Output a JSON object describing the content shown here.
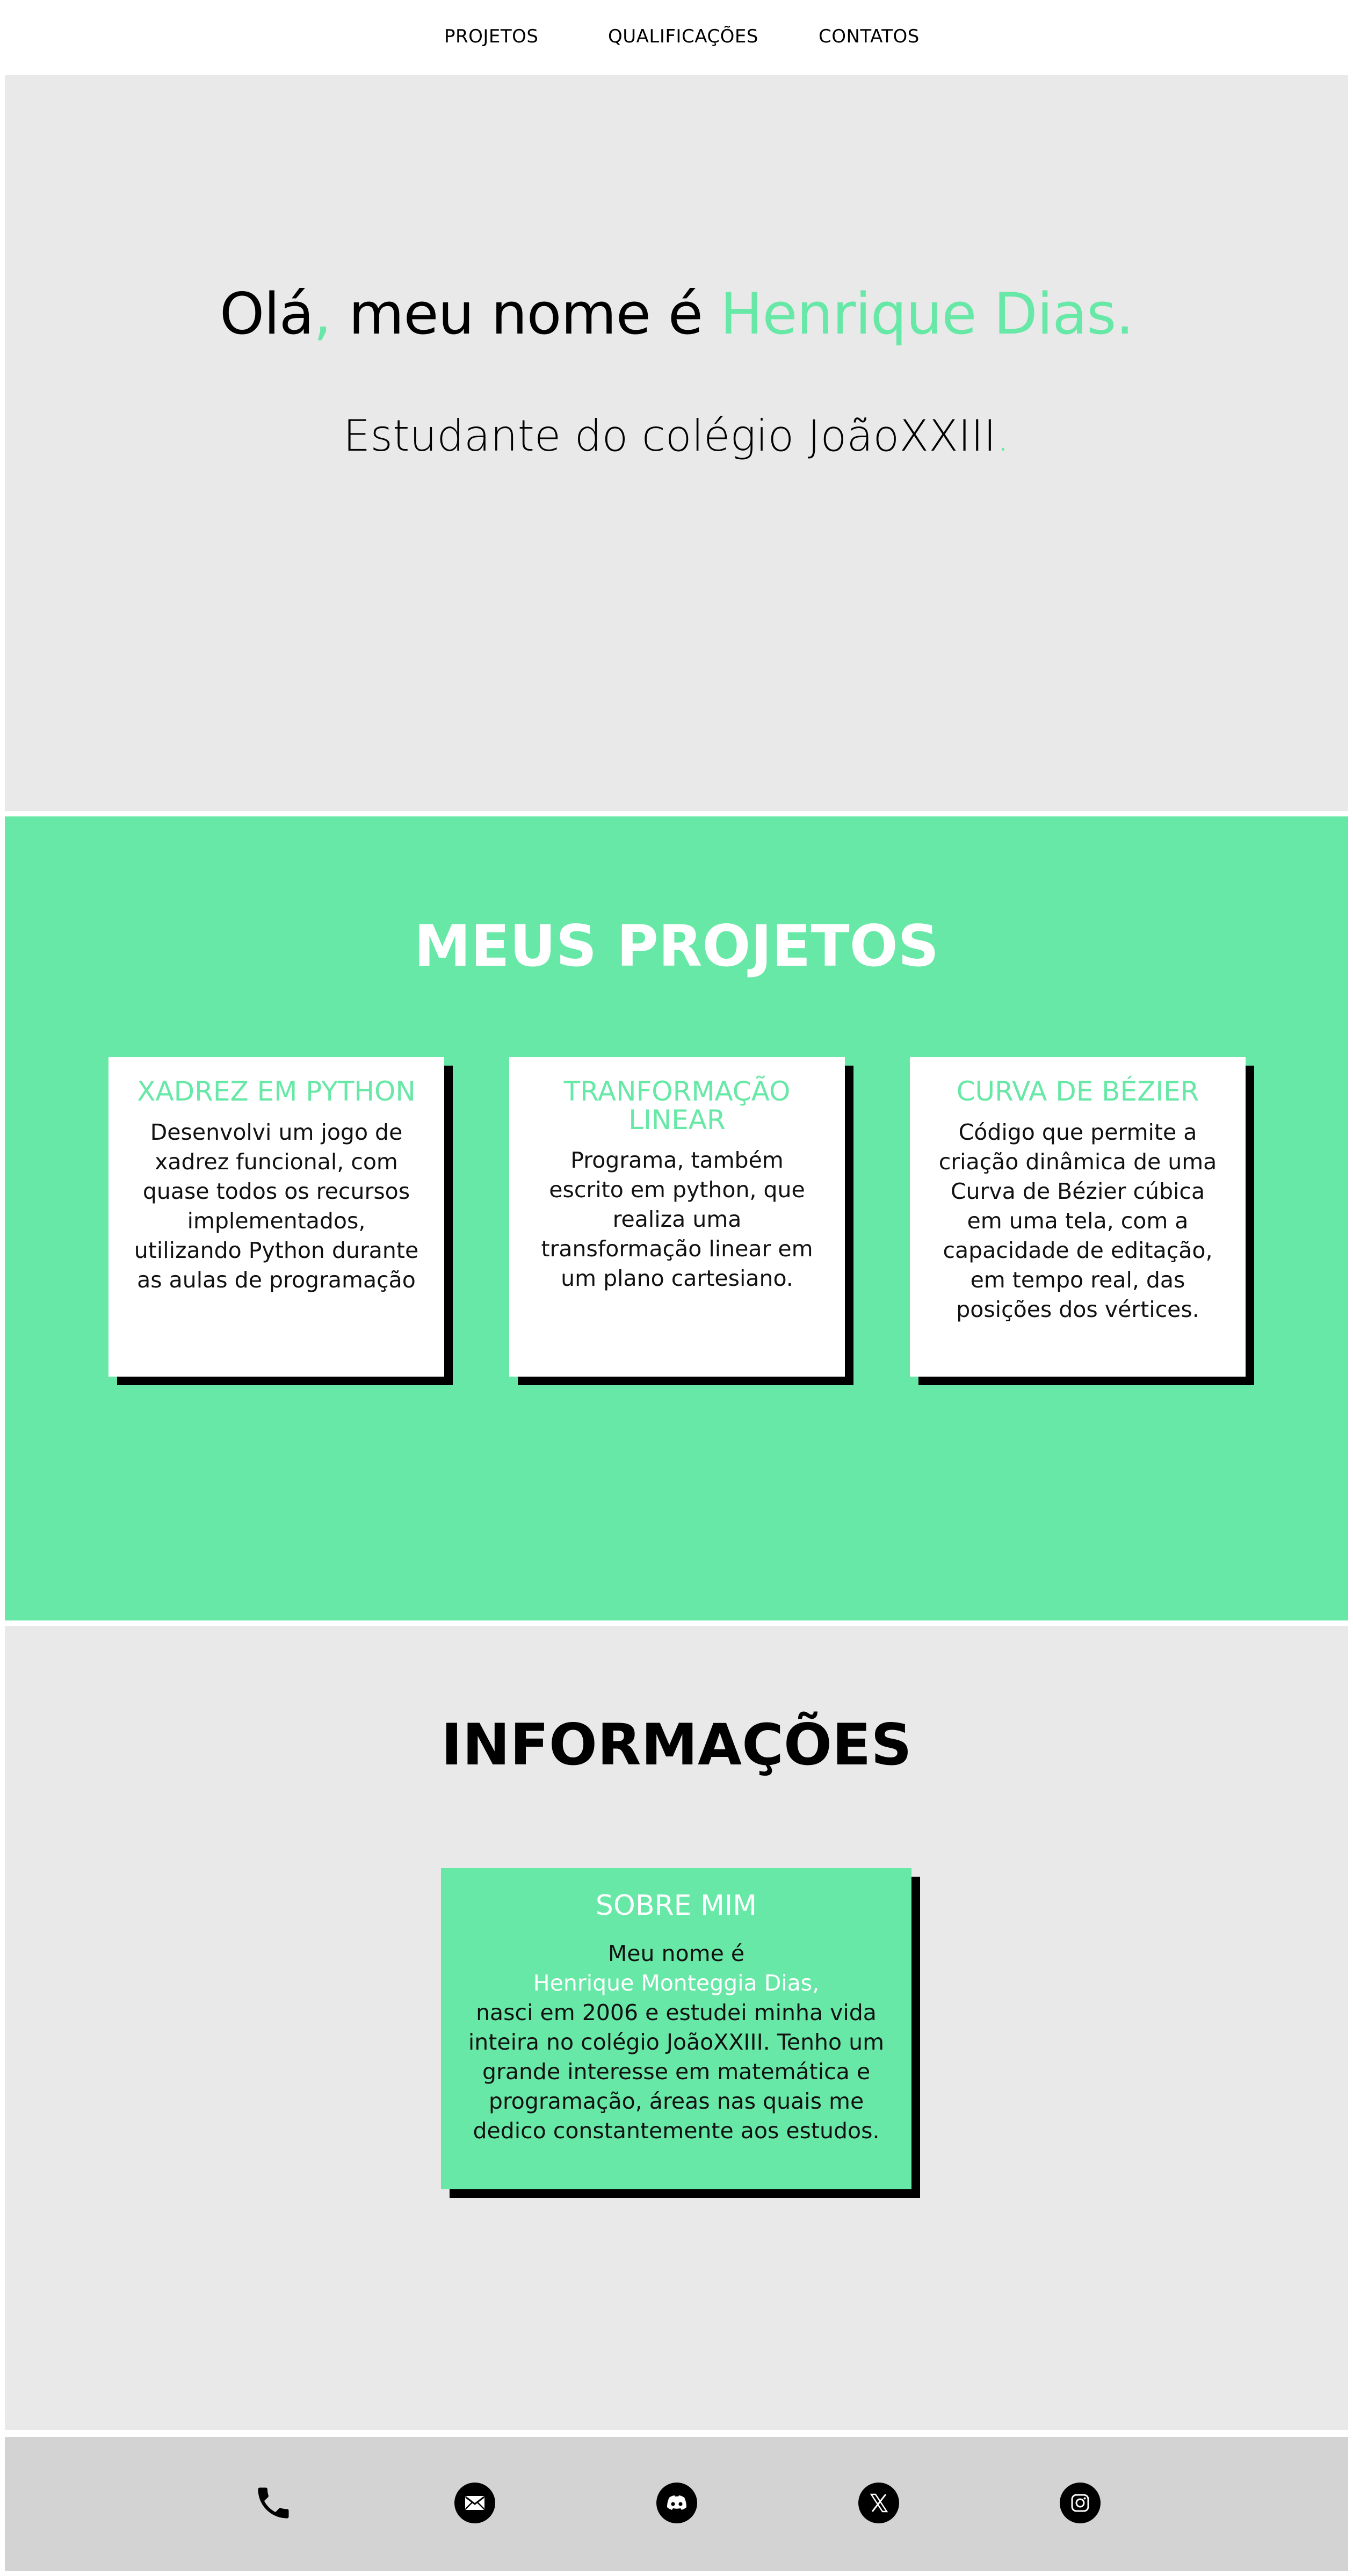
{
  "nav": {
    "items": [
      {
        "label": "PROJETOS"
      },
      {
        "label": "QUALIFICAÇÕES"
      },
      {
        "label": "CONTATOS"
      }
    ]
  },
  "hero": {
    "title_part1": "Olá",
    "title_comma": ",",
    "title_part2": " meu nome é ",
    "title_name": "Henrique Dias.",
    "subtitle": "Estudante do colégio JoãoXXIII",
    "subtitle_dot": "."
  },
  "projects": {
    "title": "MEUS PROJETOS",
    "cards": [
      {
        "title": "XADREZ EM PYTHON",
        "text": "Desenvolvi um jogo de xadrez funcional, com quase todos os recursos implementados, utilizando Python durante as aulas de programação"
      },
      {
        "title": "TRANFORMAÇÃO LINEAR",
        "text": "Programa, também escrito em python, que realiza uma transformação linear em um plano cartesiano."
      },
      {
        "title": "CURVA DE BÉZIER",
        "text": "Código que permite a criação dinâmica de uma Curva de Bézier cúbica em uma tela, com a capacidade de editação, em tempo real, das posições dos vértices."
      }
    ]
  },
  "info": {
    "title": "INFORMAÇÕES",
    "about": {
      "title": "SOBRE MIM",
      "intro": "Meu nome é",
      "name": "Henrique Monteggia Dias,",
      "text": "nasci em 2006 e estudei minha vida inteira no colégio JoãoXXIII. Tenho um grande interesse em matemática e programação, áreas nas quais me dedico constantemente aos estudos."
    }
  },
  "footer": {
    "icons": [
      "phone-icon",
      "email-icon",
      "discord-icon",
      "x-icon",
      "instagram-icon"
    ]
  },
  "colors": {
    "accent": "#67e8a6",
    "section_gray": "#e9e9e9",
    "footer_gray": "#d3d3d3"
  }
}
